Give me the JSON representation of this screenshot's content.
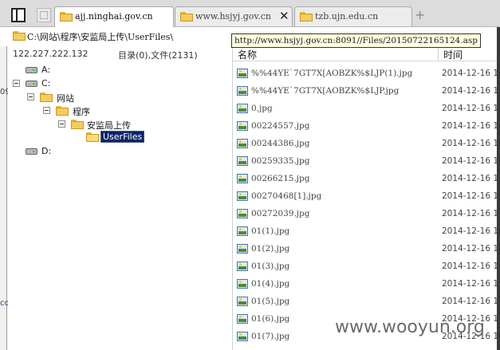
{
  "tabs": [
    {
      "label": "ajj.ninghai.gov.cn",
      "active": true
    },
    {
      "label": "www.hsjyj.gov.cn",
      "active": false
    },
    {
      "label": "tzb.ujn.edu.cn",
      "active": false
    }
  ],
  "tabstrip": {
    "new_tab": "+"
  },
  "path": {
    "value": "C:\\网站\\程序\\安监局上传\\UserFiles\\"
  },
  "tooltip": "http://www.hsjyj.gov.cn:8091//Files/20150722165124.asp",
  "server": {
    "ip": "122.227.222.132",
    "count": "目录(0),文件(2131)"
  },
  "tree": {
    "drive_a": "A:",
    "drive_c": "C:",
    "website": "网站",
    "program": "程序",
    "upload": "安监局上传",
    "userfiles": "UserFiles",
    "drive_d": "D:"
  },
  "filelist": {
    "col_name": "名称",
    "col_time": "时间",
    "rows": [
      {
        "name": "%%44YE`7GT7X[AOBZK%$LJP(1).jpg",
        "time": "2014-12-16 1"
      },
      {
        "name": "%%44YE`7GT7X[AOBZK%$LJP.jpg",
        "time": "2014-12-16 1"
      },
      {
        "name": "0.jpg",
        "time": "2014-12-16 1"
      },
      {
        "name": "00224557.jpg",
        "time": "2014-12-16 1"
      },
      {
        "name": "00244386.jpg",
        "time": "2014-12-16 1"
      },
      {
        "name": "00259335.jpg",
        "time": "2014-12-16 1"
      },
      {
        "name": "00266215.jpg",
        "time": "2014-12-16 1"
      },
      {
        "name": "00270468[1].jpg",
        "time": "2014-12-16 1"
      },
      {
        "name": "00272039.jpg",
        "time": "2014-12-16 1"
      },
      {
        "name": "01(1).jpg",
        "time": "2014-12-16 1"
      },
      {
        "name": "01(2).jpg",
        "time": "2014-12-16 1"
      },
      {
        "name": "01(3).jpg",
        "time": "2014-12-16 1"
      },
      {
        "name": "01(4).jpg",
        "time": "2014-12-16 1"
      },
      {
        "name": "01(5).jpg",
        "time": "2014-12-16 1"
      },
      {
        "name": "01(6).jpg",
        "time": "2014-12-16 1"
      },
      {
        "name": "01(7).jpg",
        "time": "2014-12-16 1"
      }
    ]
  },
  "edge": {
    "left_top": "09",
    "left_bottom": "co"
  },
  "watermark": "www.wooyun.org",
  "colors": {
    "selection": "#0a246a",
    "folder": "#f5cd5a",
    "tooltip_bg": "#ffffe1"
  }
}
